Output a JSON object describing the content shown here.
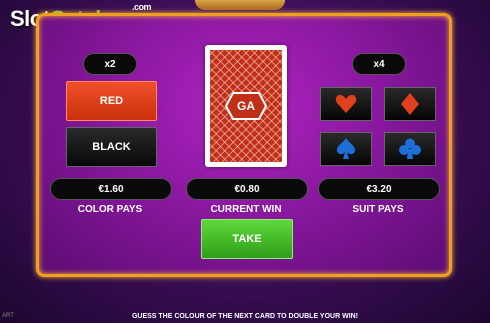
{
  "watermark": {
    "slot": "Slot",
    "catalog": "Catalog",
    "com": ".com"
  },
  "colors": {
    "accent": "#f0a020",
    "red": "#e0401c",
    "green": "#3cb82a",
    "panel": "#9a1cb0"
  },
  "color_game": {
    "multiplier": "x2",
    "red_label": "RED",
    "black_label": "BLACK",
    "pays_value": "€1.60",
    "pays_label": "COLOR PAYS"
  },
  "card": {
    "logo": "GA",
    "back_icon": "card-back"
  },
  "current_win": {
    "value": "€0.80",
    "label": "CURRENT WIN"
  },
  "suit_game": {
    "multiplier": "x4",
    "suits": [
      "hearts",
      "diamonds",
      "spades",
      "clubs"
    ],
    "pays_value": "€3.20",
    "pays_label": "SUIT PAYS"
  },
  "take_label": "TAKE",
  "footer": {
    "message": "GUESS THE COLOUR OF THE NEXT CARD TO DOUBLE YOUR WIN!",
    "corner": "ART"
  }
}
